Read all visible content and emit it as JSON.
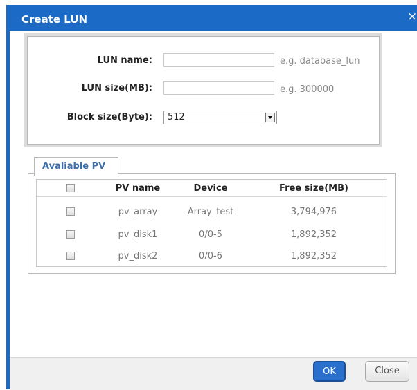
{
  "dialog": {
    "title": "Create LUN",
    "close_icon": "×"
  },
  "form": {
    "lun_name_label": "LUN name:",
    "lun_name_value": "",
    "lun_name_hint": "e.g. database_lun",
    "lun_size_label": "LUN size(MB):",
    "lun_size_value": "",
    "lun_size_hint": "e.g. 300000",
    "block_size_label": "Block size(Byte):",
    "block_size_value": "512"
  },
  "pv_tab": {
    "label": "Avaliable PV"
  },
  "pv_table": {
    "headers": [
      "PV name",
      "Device",
      "Free size(MB)"
    ],
    "rows": [
      {
        "name": "pv_array",
        "device": "Array_test",
        "free": "3,794,976",
        "checked": false
      },
      {
        "name": "pv_disk1",
        "device": "0/0-5",
        "free": "1,892,352",
        "checked": false
      },
      {
        "name": "pv_disk2",
        "device": "0/0-6",
        "free": "1,892,352",
        "checked": false
      }
    ]
  },
  "footer": {
    "ok_label": "OK",
    "close_label": "Close"
  },
  "colors": {
    "titlebar": "#1b6ac6",
    "tab_text": "#3c6ea8",
    "ok_button": "#2a6fcc"
  }
}
